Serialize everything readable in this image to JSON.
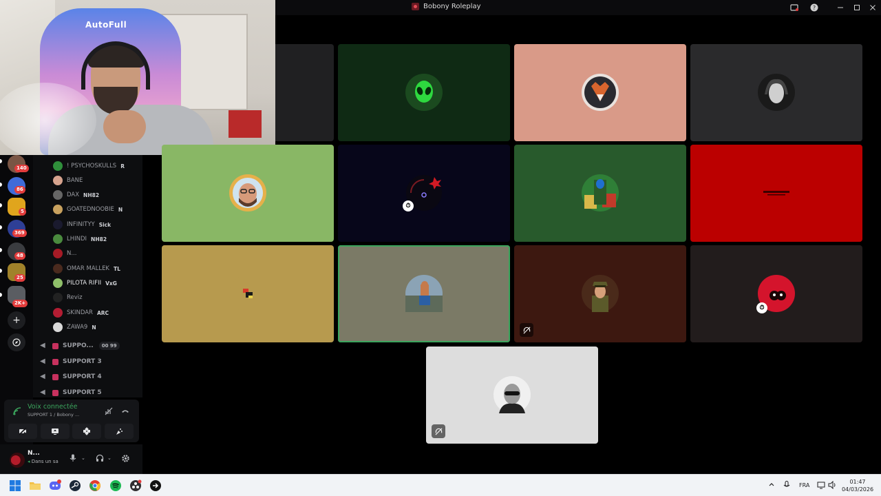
{
  "window": {
    "title": "Bobony Roleplay",
    "icons": [
      "window-logo-icon",
      "inbox-icon",
      "help-icon",
      "minimize-icon",
      "maximize-icon",
      "close-icon"
    ]
  },
  "webcam": {
    "brand": "AutoFull"
  },
  "servers": [
    {
      "badge": "140",
      "color": "#7a5544"
    },
    {
      "badge": "86",
      "color": "#3f6bd8"
    },
    {
      "badge": "5",
      "color": "#e0a51d"
    },
    {
      "badge": "369",
      "color": "#2e3f96"
    },
    {
      "badge": "48",
      "color": "#3a3c40"
    },
    {
      "badge": "25",
      "color": "#a0822a"
    },
    {
      "badge": "2K+",
      "color": "#5a5d62"
    }
  ],
  "members": [
    {
      "name": "! PSYCHOSKULLS",
      "tag": "R",
      "color": "#2f8f3b"
    },
    {
      "name": "BANE",
      "tag": "",
      "color": "#d6a38e"
    },
    {
      "name": "DAX",
      "tag": "NH82",
      "color": "#666"
    },
    {
      "name": "GOATEDNOOBIE",
      "tag": "N",
      "color": "#c8a15e"
    },
    {
      "name": "INFINITYY",
      "tag": "Sick",
      "color": "#1a1a2e"
    },
    {
      "name": "LHINDI",
      "tag": "NH82",
      "color": "#4a8a3e"
    },
    {
      "name": "N...",
      "tag": "",
      "color": "#a51b26"
    },
    {
      "name": "OMAR MALLEK",
      "tag": "TL",
      "color": "#4a2a1e"
    },
    {
      "name": "PILOTA RIFII",
      "tag": "VxG",
      "color": "#8fbf6a"
    },
    {
      "name": "Reviz",
      "tag": "",
      "color": "#222"
    },
    {
      "name": "SKINDAR",
      "tag": "ARC",
      "color": "#b31d33"
    },
    {
      "name": "ZAWA9",
      "tag": "N",
      "color": "#d9d9d9"
    }
  ],
  "voice_channels": [
    {
      "name": "SUPPO...",
      "counts": [
        "00",
        "99"
      ]
    },
    {
      "name": "SUPPORT 3"
    },
    {
      "name": "SUPPORT 4"
    },
    {
      "name": "SUPPORT 5"
    }
  ],
  "voice_panel": {
    "status": "Voix connectée",
    "channel": "SUPPORT 1 / Bobony ..."
  },
  "user": {
    "name": "N...",
    "status": "Dans un sa"
  },
  "tiles": [
    {
      "bg": "#202022",
      "avatar": ""
    },
    {
      "bg": "#0f2a14",
      "avatar": "#2ed83f"
    },
    {
      "bg": "#d99a88",
      "avatar": "#8c3a26"
    },
    {
      "bg": "#2a2a2c",
      "avatar": "#d8d8d8"
    },
    {
      "bg": "#89b765",
      "avatar": "#d7a14a"
    },
    {
      "bg": "#07061a",
      "avatar": "#2a0a10"
    },
    {
      "bg": "#285a2c",
      "avatar": "#2f7f37"
    },
    {
      "bg": "#bb0000",
      "avatar": "#8a0000"
    },
    {
      "bg": "#b79a4e",
      "avatar": "#b79a4e"
    },
    {
      "bg": "#7b7a66",
      "avatar": "#6a7d8a"
    },
    {
      "bg": "#3d1810",
      "avatar": "#6a4a2a"
    },
    {
      "bg": "#221c1c",
      "avatar": "#d4142c"
    },
    {
      "bg": "#dddddd",
      "avatar": "#f0f0f0"
    }
  ],
  "taskbar": {
    "lang": "FRA",
    "time": "01:47",
    "date": "04/03/2026",
    "apps": [
      "windows-start-icon",
      "file-explorer-icon",
      "discord-icon",
      "steam-icon",
      "chrome-icon",
      "spotify-icon",
      "obs-icon",
      "app-icon"
    ]
  }
}
